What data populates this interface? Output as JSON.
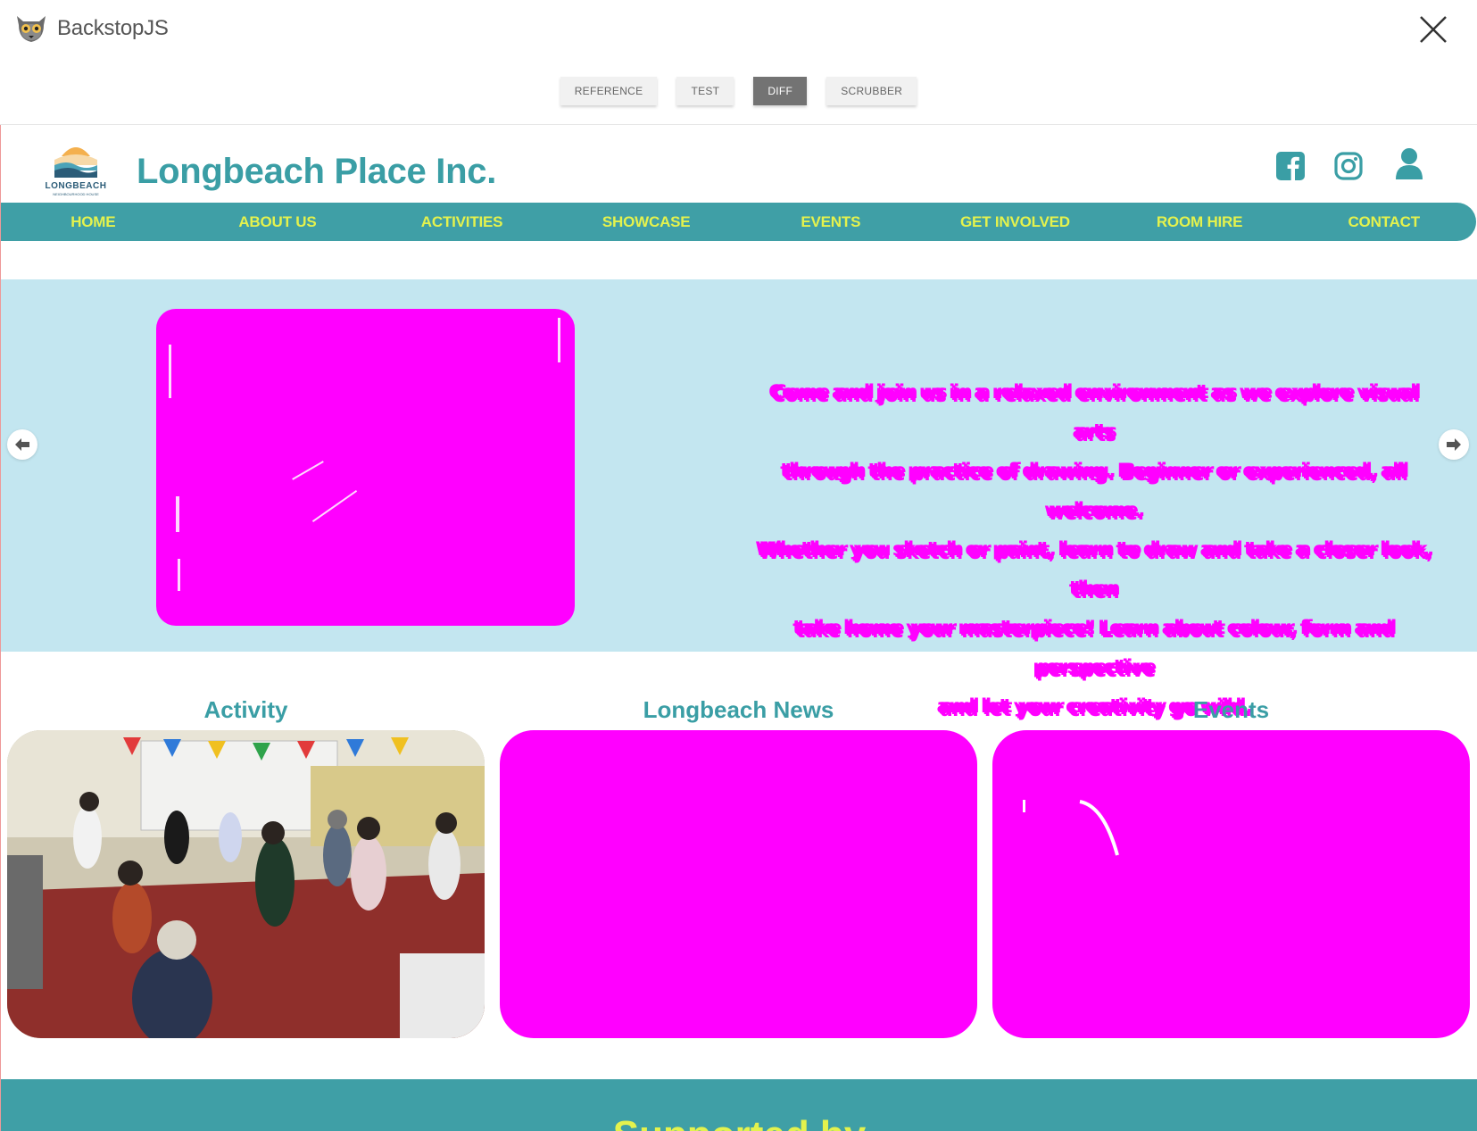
{
  "backstop": {
    "title": "BackstopJS",
    "modes": [
      "REFERENCE",
      "TEST",
      "DIFF",
      "SCRUBBER"
    ],
    "active_mode": "DIFF"
  },
  "site": {
    "name": "Longbeach Place Inc.",
    "logo_text": "LONGBEACH",
    "logo_subtext": "NEIGHBOURHOOD HOUSE",
    "nav": [
      "HOME",
      "ABOUT US",
      "ACTIVITIES",
      "SHOWCASE",
      "EVENTS",
      "GET INVOLVED",
      "ROOM HIRE",
      "CONTACT"
    ],
    "social_icons": [
      "facebook-icon",
      "instagram-icon",
      "user-icon"
    ],
    "hero": {
      "lines": [
        "Come and join us in a relaxed environment as we explore visual arts",
        "through the practice of drawing. Beginner or experienced, all welcome.",
        "Whether you sketch or paint, learn to draw and take a closer look, then",
        "take home your masterpiece! Learn about colour, form and perspective",
        "and let your creativity go wild."
      ]
    },
    "cards": [
      {
        "title": "Activity"
      },
      {
        "title": "Longbeach News"
      },
      {
        "title": "Events"
      }
    ],
    "footer_title": "Supported by"
  },
  "colors": {
    "teal": "#3f9fa6",
    "nav_text": "#e4f24d",
    "hero_bg": "#c3e6f0",
    "diff_magenta": "#ff00ff"
  }
}
